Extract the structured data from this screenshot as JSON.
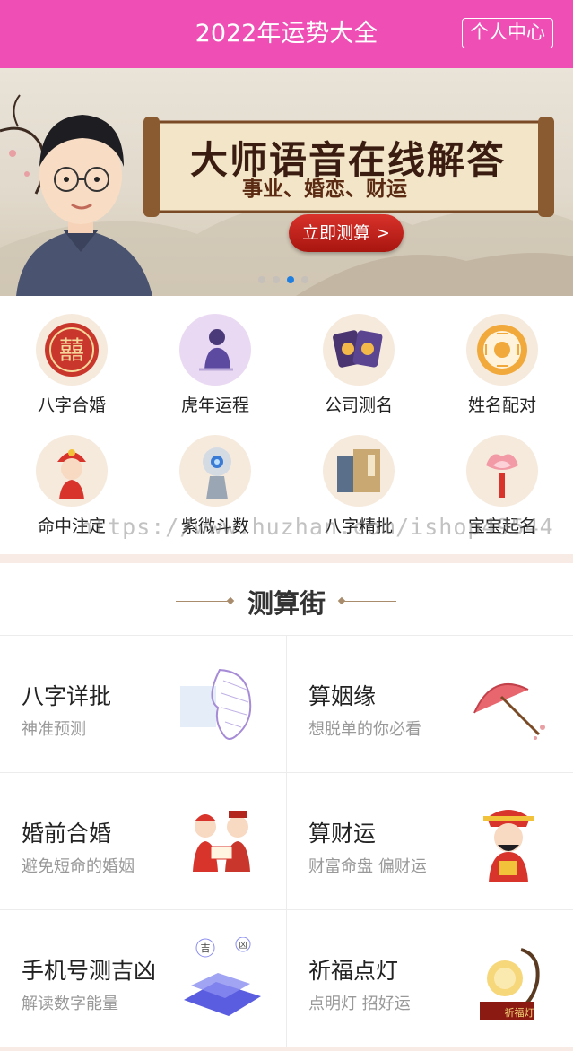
{
  "header": {
    "title": "2022年运势大全",
    "user_center": "个人中心",
    "bg_color": "#ef4eb5"
  },
  "banner": {
    "headline": "大师语音在线解答",
    "subline": "事业、婚恋、财运",
    "cta": "立即测算 >",
    "active_slide": 3,
    "slide_count": 4
  },
  "grid": [
    {
      "label": "八字合婚",
      "icon": "double-happiness-icon"
    },
    {
      "label": "虎年运程",
      "icon": "sitting-person-icon"
    },
    {
      "label": "公司测名",
      "icon": "cards-icon"
    },
    {
      "label": "姓名配对",
      "icon": "bagua-icon"
    },
    {
      "label": "命中注定",
      "icon": "bride-icon"
    },
    {
      "label": "紫微斗数",
      "icon": "robot-icon"
    },
    {
      "label": "八字精批",
      "icon": "books-icon"
    },
    {
      "label": "宝宝起名",
      "icon": "lotus-lamp-icon"
    }
  ],
  "watermark": "https://www.huzhan.com/ishop49544",
  "section": {
    "title": "测算街"
  },
  "cards": [
    {
      "title": "八字详批",
      "subtitle": "神准预测",
      "icon": "face-scan-icon"
    },
    {
      "title": "算姻缘",
      "subtitle": "想脱单的你必看",
      "icon": "umbrella-icon"
    },
    {
      "title": "婚前合婚",
      "subtitle": "避免短命的婚姻",
      "icon": "couple-icon"
    },
    {
      "title": "算财运",
      "subtitle": "财富命盘 偏财运",
      "icon": "god-of-wealth-icon"
    },
    {
      "title": "手机号测吉凶",
      "subtitle": "解读数字能量",
      "icon": "phone-number-icon"
    },
    {
      "title": "祈福点灯",
      "subtitle": "点明灯 招好运",
      "icon": "blessing-lamp-icon",
      "badge": "祈福灯"
    }
  ]
}
